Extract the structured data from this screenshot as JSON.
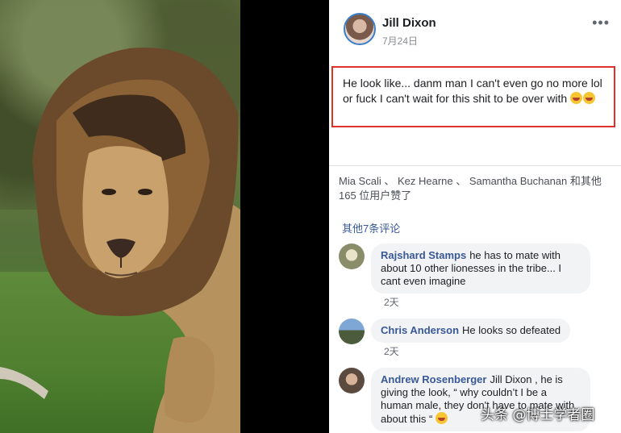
{
  "post": {
    "author": "Jill Dixon",
    "date": "7月24日",
    "more_label": "•••",
    "text": "He look like... danm man I can't even go no more lol or fuck I can't wait for this shit to be over with",
    "emoji": "grinning-tears"
  },
  "likes_text": "Mia Scali 、 Kez Hearne 、 Samantha Buchanan 和其他 165 位用户赞了",
  "more_comments_label": "其他7条评论",
  "comments": [
    {
      "name": "Rajshard Stamps",
      "text": "he has to mate with about 10 other lionesses in the tribe... I cant even imagine",
      "time": "2天"
    },
    {
      "name": "Chris Anderson",
      "text": "He looks so defeated",
      "time": "2天"
    },
    {
      "name": "Andrew Rosenberger",
      "text": "Jill Dixon , he is giving the look, “ why couldn’t I be a human male, they don't have to mate with about this “",
      "time": ""
    }
  ],
  "watermark": "头条 @博士学者圈",
  "colors": {
    "highlight_border": "#e0302a",
    "link_blue": "#385898",
    "bubble_bg": "#f2f3f5"
  }
}
